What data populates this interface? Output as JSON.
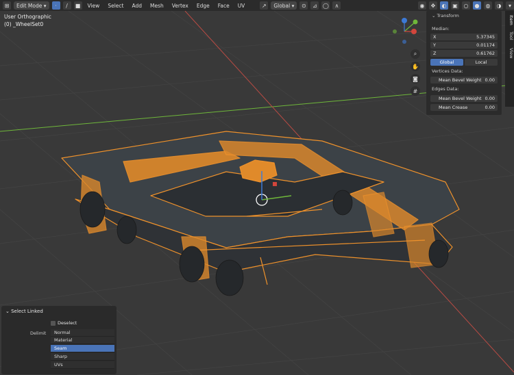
{
  "header": {
    "mode": "Edit Mode",
    "menus": [
      "View",
      "Select",
      "Add",
      "Mesh",
      "Vertex",
      "Edge",
      "Face",
      "UV"
    ],
    "transform_orientation": "Global"
  },
  "viewport": {
    "view_name": "User Orthographic",
    "object_name": "(0) _WheelSet0"
  },
  "npanel": {
    "section_title": "Transform",
    "median_label": "Median:",
    "x_label": "X",
    "x_value": "5.37345",
    "y_label": "Y",
    "y_value": "0.01174",
    "z_label": "Z",
    "z_value": "0.61762",
    "global_label": "Global",
    "local_label": "Local",
    "vertices_data_label": "Vertices Data:",
    "mean_bevel_weight_label": "Mean Bevel Weight",
    "mean_bevel_weight_value": "0.00",
    "edges_data_label": "Edges Data:",
    "edge_mean_bevel_weight_label": "Mean Bevel Weight",
    "edge_mean_bevel_weight_value": "0.00",
    "mean_crease_label": "Mean Crease",
    "mean_crease_value": "0.00"
  },
  "side_tabs": [
    "Item",
    "Tool",
    "View"
  ],
  "operator_panel": {
    "title": "Select Linked",
    "deselect_label": "Deselect",
    "delimit_label": "Delimit",
    "options": [
      {
        "label": "Normal",
        "selected": false
      },
      {
        "label": "Material",
        "selected": false
      },
      {
        "label": "Seam",
        "selected": true
      },
      {
        "label": "Sharp",
        "selected": false
      },
      {
        "label": "UVs",
        "selected": false
      }
    ]
  },
  "colors": {
    "selection_orange": "#f0922b",
    "active_blue": "#4a74b8",
    "axis_x": "#d2463c",
    "axis_y": "#6fb83a",
    "axis_z": "#3d7ad6"
  }
}
